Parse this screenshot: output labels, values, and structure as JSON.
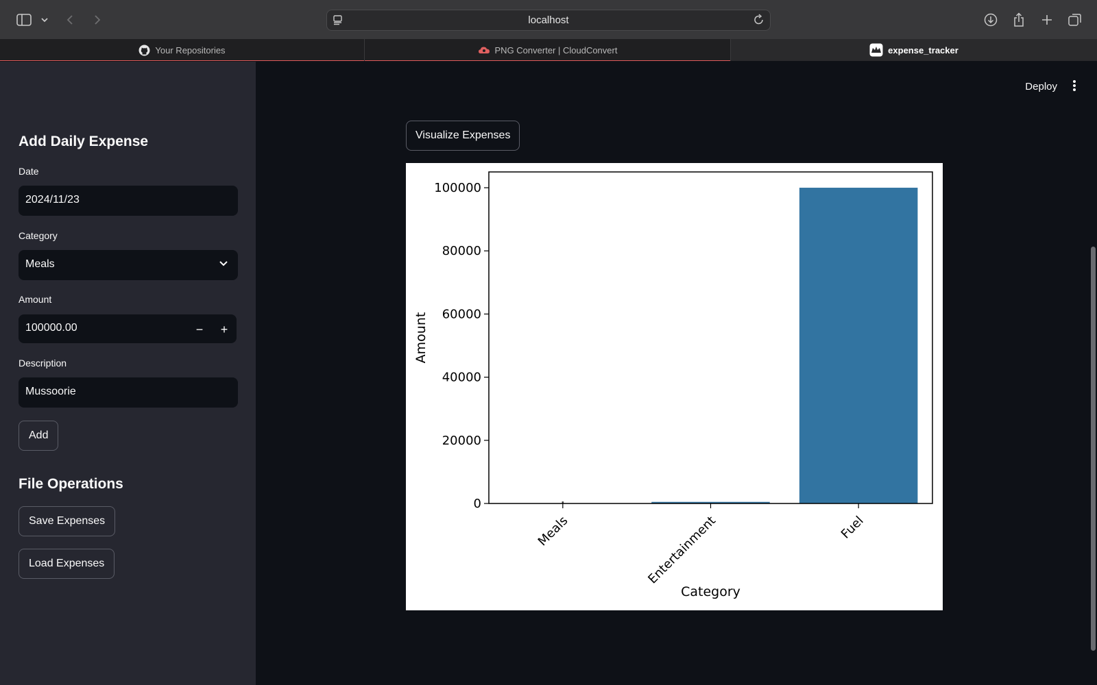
{
  "browser": {
    "url": "localhost",
    "tabs": [
      {
        "label": "Your Repositories"
      },
      {
        "label": "PNG Converter | CloudConvert"
      },
      {
        "label": "expense_tracker"
      }
    ]
  },
  "sidebar": {
    "add_heading": "Add Daily Expense",
    "date_label": "Date",
    "date_value": "2024/11/23",
    "category_label": "Category",
    "category_value": "Meals",
    "amount_label": "Amount",
    "amount_value": "100000.00",
    "minus": "−",
    "plus": "+",
    "description_label": "Description",
    "description_value": "Mussoorie",
    "add_button": "Add",
    "file_heading": "File Operations",
    "save_button": "Save Expenses",
    "load_button": "Load Expenses"
  },
  "main": {
    "deploy": "Deploy",
    "visualize_button": "Visualize Expenses"
  },
  "chart_data": {
    "type": "bar",
    "categories": [
      "Meals",
      "Entertainment",
      "Fuel"
    ],
    "values": [
      100,
      500,
      100000
    ],
    "xlabel": "Category",
    "ylabel": "Amount",
    "ylim": [
      0,
      105000
    ],
    "yticks": [
      0,
      20000,
      40000,
      60000,
      80000,
      100000
    ],
    "bar_color": "#3274a1",
    "grid": false
  }
}
